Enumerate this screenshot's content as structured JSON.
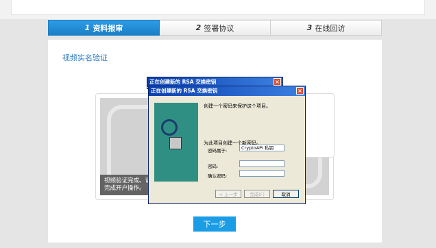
{
  "steps": [
    {
      "num": "1",
      "label": "资料报审",
      "active": true
    },
    {
      "num": "2",
      "label": "签署协议",
      "active": false
    },
    {
      "num": "3",
      "label": "在线回访",
      "active": false
    }
  ],
  "section_title": "视频实名验证",
  "video": {
    "message": "视频验证完成。请点\n完成开户操作。"
  },
  "next_button": "下一步",
  "dialog_back": {
    "title": "正在创建新的 RSA 交换密钥"
  },
  "dialog_front": {
    "title": "正在创建新的 RSA 交换密钥",
    "line1": "创建一个密码来保护这个项目。",
    "line2": "为此项目创建一个新密码。",
    "password_for_label": "密码属于:",
    "password_for_value": "CryptoAPI 私钥",
    "password_label": "密码:",
    "password_value": "",
    "confirm_label": "确认密码:",
    "confirm_value": "",
    "btn_back": "< 上一步",
    "btn_finish": "完成(F)",
    "btn_cancel": "取消"
  },
  "colors": {
    "accent": "#1b9de6",
    "title_blue": "#0a3fb0"
  }
}
